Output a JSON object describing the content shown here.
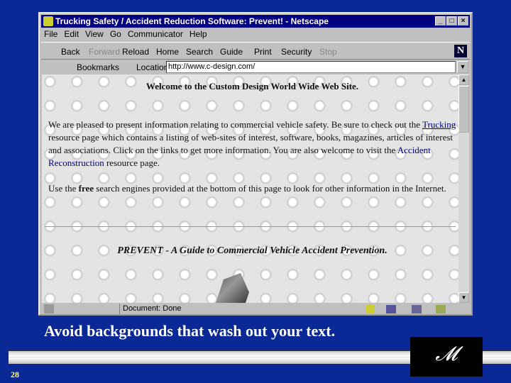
{
  "window": {
    "title": "Trucking Safety / Accident Reduction Software: Prevent! - Netscape"
  },
  "menu": [
    "File",
    "Edit",
    "View",
    "Go",
    "Communicator",
    "Help"
  ],
  "toolbar": {
    "back": "Back",
    "forward": "Forward",
    "reload": "Reload",
    "home": "Home",
    "search": "Search",
    "guide": "Guide",
    "print": "Print",
    "security": "Security",
    "stop": "Stop"
  },
  "location": {
    "bookmarks": "Bookmarks",
    "label": "Location:",
    "url": "http://www.c-design.com/"
  },
  "page": {
    "heading": "Welcome to the Custom Design World Wide Web Site.",
    "p1_a": "We are pleased to present information relating to commercial vehicle safety. Be sure to check out the ",
    "link_trucking": "Trucking",
    "p1_b": " resource page which contains a listing of web-sites of interest, software, books, magazines, articles of interest and associations. Click on the links to get more information. You are also welcome to visit the ",
    "link_accident": "Accident Reconstruction",
    "p1_c": " resource page.",
    "p2_a": "Use the ",
    "p2_bold": "free",
    "p2_b": " search engines provided at the bottom of this page to look for other information in the Internet.",
    "prevent": "PREVENT - A Guide to Commercial Vehicle Accident Prevention."
  },
  "status": "Document: Done",
  "slide": {
    "caption": "Avoid backgrounds that wash out your text.",
    "page_number": "28",
    "logo": "Mark"
  }
}
